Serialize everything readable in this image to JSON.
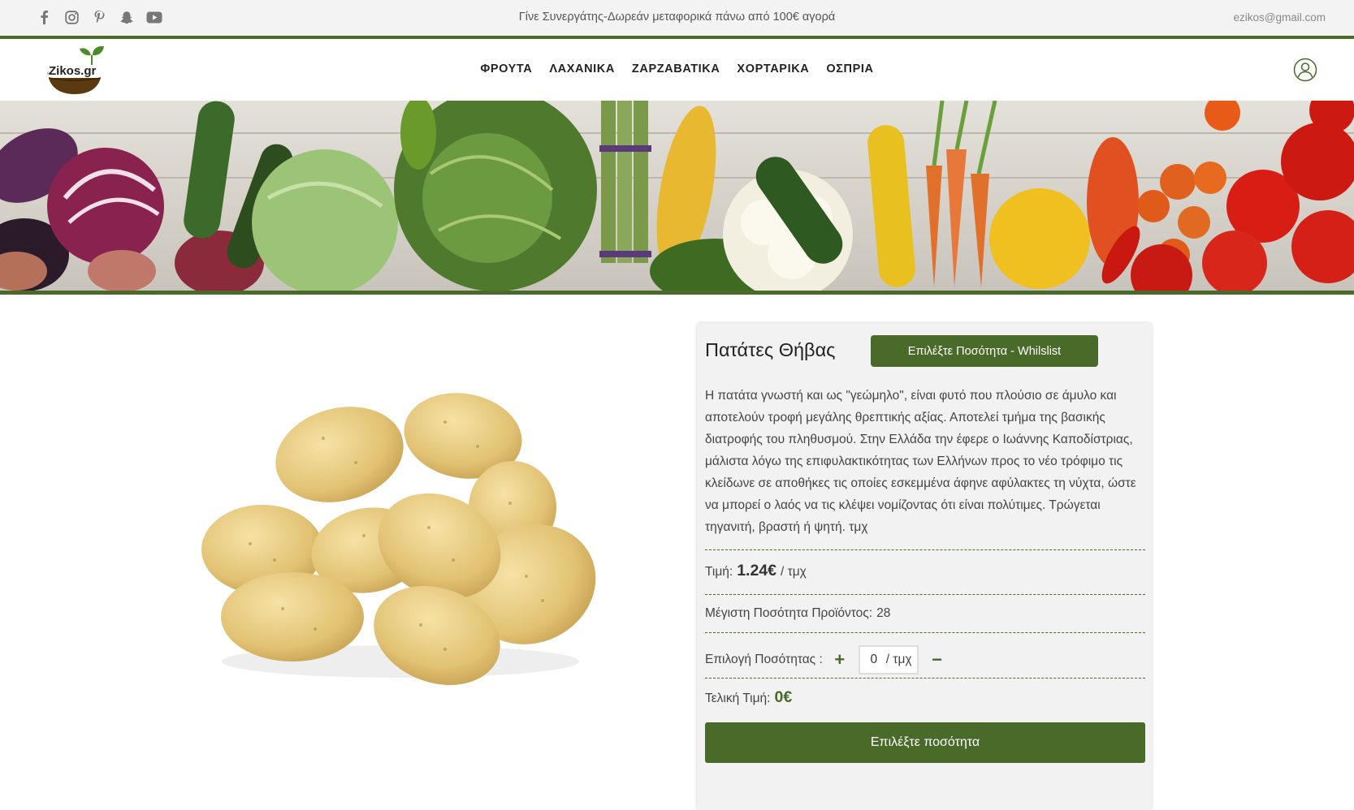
{
  "topbar": {
    "social_icons": [
      "facebook-icon",
      "instagram-icon",
      "pinterest-icon",
      "snapchat-icon",
      "youtube-icon"
    ],
    "promo": "Γίνε Συνεργάτης-Δωρεάν μεταφορικά πάνω από 100€ αγορά",
    "email": "ezikos@gmail.com"
  },
  "header": {
    "logo_text": "eZikos.gr",
    "nav": [
      "ΦΡΟΥΤΑ",
      "ΛΑΧΑΝΙΚΑ",
      "ΖΑΡΖΑΒΑΤΙΚΑ",
      "ΧΟΡΤΑΡΙΚΑ",
      "ΟΣΠΡΙΑ"
    ]
  },
  "product": {
    "title": "Πατάτες Θήβας",
    "wishlist_label": "Επιλέξτε Ποσότητα - Whilslist",
    "description": "Η πατάτα γνωστή και ως \"γεώμηλο\", είναι φυτό που πλούσιο σε άμυλο και αποτελούν τροφή μεγάλης θρεπτικής αξίας. Αποτελεί τμήμα της βασικής διατροφής του πληθυσμού. Στην Ελλάδα την έφερε ο Ιωάννης Καποδίστριας, μάλιστα λόγω της επιφυλακτικότητας των Ελλήνων προς το νέο τρόφιμο τις κλείδωνε σε αποθήκες τις οποίες εσκεμμένα άφηνε αφύλακτες τη νύχτα, ώστε να μπορεί ο λαός να τις κλέψει νομίζοντας ότι είναι πολύτιμες. Τρώγεται τηγανιτή, βραστή ή ψητή. τμχ",
    "price_label": "Τιμή:",
    "price_value": "1.24€",
    "price_unit": "/ τμχ",
    "max_qty_label": "Μέγιστη Ποσότητα Προϊόντος:",
    "max_qty_value": "28",
    "qty_label": "Επιλογή Ποσότητας :",
    "qty_plus": "+",
    "qty_value": "0",
    "qty_unit": "/ τμχ",
    "qty_minus": "−",
    "final_label": "Τελική Τιμή:",
    "final_value": "0€",
    "select_button": "Επιλέξτε ποσότητα"
  },
  "colors": {
    "brand_green": "#4a6a2a",
    "topbar_bg": "#f3f3f3",
    "panel_bg": "#f2f2f2"
  }
}
